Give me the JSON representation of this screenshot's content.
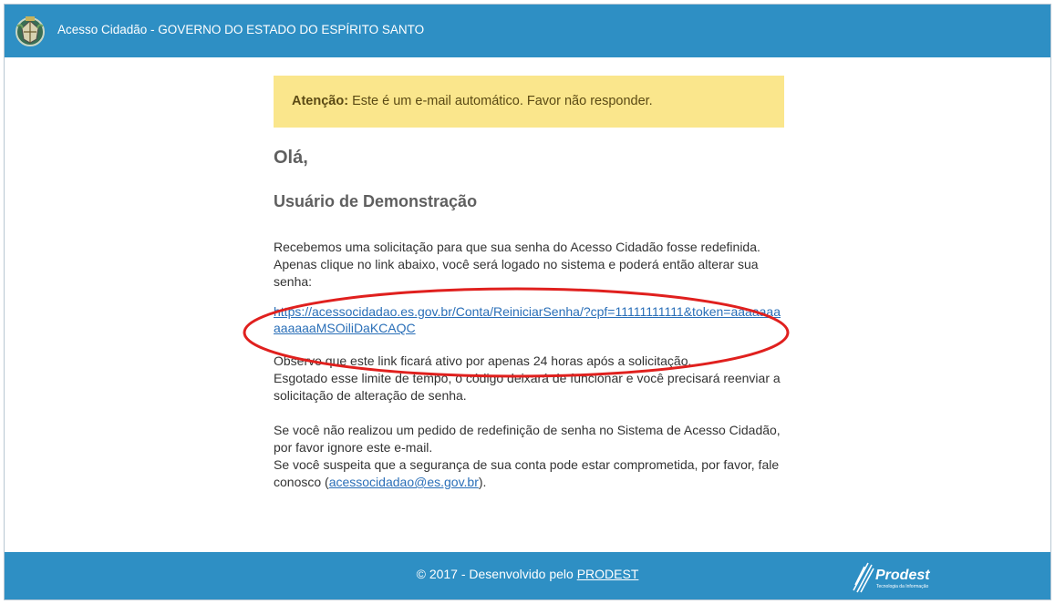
{
  "header": {
    "title": "Acesso Cidadão - GOVERNO DO ESTADO DO ESPÍRITO SANTO",
    "logo_icon": "state-coat-of-arms-icon"
  },
  "alert": {
    "label": "Atenção:",
    "text": " Este é um e-mail automático. Favor não responder."
  },
  "greeting": "Olá,",
  "username": "Usuário de Demonstração",
  "paragraphs": {
    "p1": "Recebemos uma solicitação para que sua senha do Acesso Cidadão fosse redefinida. Apenas clique no link abaixo, você será logado no sistema e poderá então alterar sua senha:",
    "link": "https://acessocidadao.es.gov.br/Conta/ReiniciarSenha/?cpf=11111111111&token=aaaaaaaaaaaaaMSOiliDaKCAQC",
    "p2_line1": "Observe que este link ficará ativo por apenas 24 horas após a solicitação.",
    "p2_line2": "Esgotado esse limite de tempo, o código deixará de funcionar e você precisará reenviar a solicitação de alteração de senha.",
    "p3_line1": "Se você não realizou um pedido de redefinição de senha no Sistema de Acesso Cidadão, por favor ignore este e-mail.",
    "p3_line2_pre": "Se você suspeita que a segurança de sua conta pode estar comprometida, por favor, fale conosco (",
    "p3_email": "acessocidadao@es.gov.br",
    "p3_line2_post": ")."
  },
  "footer": {
    "text_pre": "© 2017 - Desenvolvido pelo ",
    "link": "PRODEST",
    "brand": "Prodest",
    "brand_sub": "Tecnologia da Informação",
    "brand_icon": "prodest-logo-icon"
  },
  "colors": {
    "header": "#2e8fc4",
    "alert": "#fae68c",
    "link": "#2a6fb8",
    "annotation": "#e0201e"
  }
}
